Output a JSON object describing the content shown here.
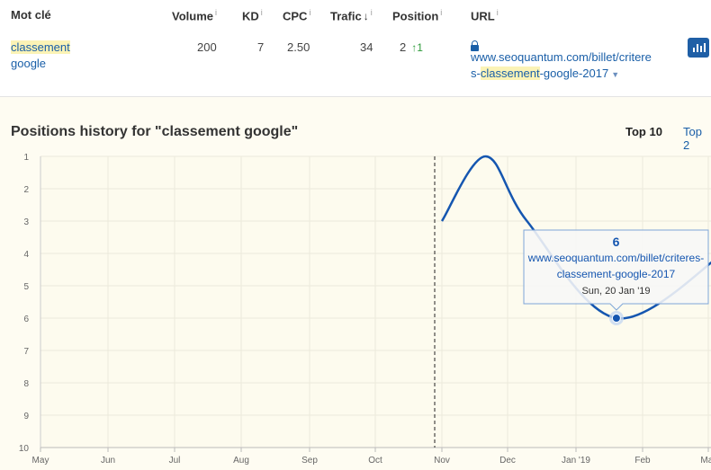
{
  "table": {
    "headers": {
      "keyword": "Mot clé",
      "volume": "Volume",
      "kd": "KD",
      "cpc": "CPC",
      "traffic": "Trafic",
      "position": "Position",
      "url": "URL",
      "info_mark": "i",
      "sort_arrow": "↓"
    },
    "row": {
      "keyword_line1": "classement",
      "keyword_line2": "google",
      "volume": "200",
      "kd": "7",
      "cpc": "2.50",
      "traffic": "34",
      "position": "2",
      "position_change": "↑1",
      "url_line1": "www.seoquantum.com/billet/critere",
      "url_line2_pre": "s-",
      "url_line2_hl": "classement",
      "url_line2_post": "-google-2017"
    }
  },
  "history": {
    "title": "Positions history for \"classement google\"",
    "tabs": [
      "Top 10",
      "Top 2"
    ]
  },
  "chart_data": {
    "type": "line",
    "title": "Positions history for \"classement google\"",
    "xlabel": "",
    "ylabel": "",
    "x_ticks": [
      "May",
      "Jun",
      "Jul",
      "Aug",
      "Sep",
      "Oct",
      "Nov",
      "Dec",
      "Jan '19",
      "Feb",
      "Mar"
    ],
    "y_ticks": [
      1,
      2,
      3,
      4,
      5,
      6,
      7,
      8,
      9,
      10
    ],
    "ylim": [
      1,
      10
    ],
    "y_inverted": true,
    "grid": true,
    "marker_line": "Nov",
    "series": [
      {
        "x": [
          "2018-11-01",
          "2018-11-21",
          "2018-12-10",
          "2019-01-20",
          "2019-03-10"
        ],
        "values": [
          3,
          1,
          3,
          6,
          4
        ]
      }
    ],
    "tooltip": {
      "value": "6",
      "url_line1": "www.seoquantum.com/billet/criteres-",
      "url_line2": "classement-google-2017",
      "date": "Sun, 20 Jan '19"
    }
  },
  "colors": {
    "line": "#1556b0",
    "panel_bg": "#fefcf2",
    "highlight": "#fbf3b6"
  }
}
